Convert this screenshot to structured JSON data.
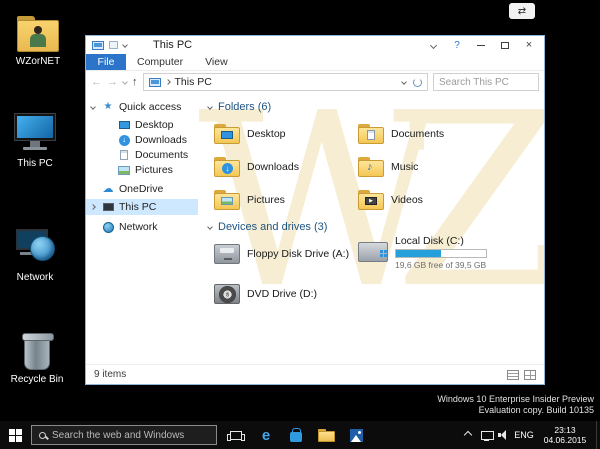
{
  "glyphs": {
    "close": "×",
    "swap_arrows": "⇄",
    "back": "←",
    "forward": "→",
    "up": "↑",
    "star": "★",
    "cloud": "☁",
    "down_arrow": "↓",
    "music_note": "♪",
    "play": "▶",
    "edge": "e",
    "dvd": "DVD",
    "help": "?"
  },
  "desktop": {
    "icons": [
      {
        "label": "WZorNET"
      },
      {
        "label": "This PC"
      },
      {
        "label": "Network"
      },
      {
        "label": "Recycle Bin"
      }
    ],
    "build_watermark": {
      "line1": "Windows 10 Enterprise Insider Preview",
      "line2": "Evaluation copy. Build 10135"
    },
    "wz_watermark": "WZ"
  },
  "window": {
    "title": "This PC",
    "tabs": {
      "file": "File",
      "computer": "Computer",
      "view": "View"
    },
    "address": {
      "breadcrumb": "This PC",
      "search_placeholder": "Search This PC"
    },
    "sidebar": [
      {
        "label": "Quick access"
      },
      {
        "label": "Desktop"
      },
      {
        "label": "Downloads"
      },
      {
        "label": "Documents"
      },
      {
        "label": "Pictures"
      },
      {
        "label": "OneDrive"
      },
      {
        "label": "This PC"
      },
      {
        "label": "Network"
      }
    ],
    "folders_section": {
      "title": "Folders (6)",
      "items": [
        "Desktop",
        "Documents",
        "Downloads",
        "Music",
        "Pictures",
        "Videos"
      ]
    },
    "devices_section": {
      "title": "Devices and drives (3)",
      "items": [
        {
          "label": "Floppy Disk Drive (A:)"
        },
        {
          "label": "Local Disk (C:)",
          "capacity": "19,6 GB free of 39,5 GB",
          "fill_width": "50%"
        },
        {
          "label": "DVD Drive (D:)"
        }
      ]
    },
    "status_bar": {
      "items_count": "9 items"
    }
  },
  "taskbar": {
    "search_placeholder": "Search the web and Windows",
    "tray": {
      "language": "ENG",
      "time": "23:13",
      "date": "04.06.2015"
    }
  }
}
